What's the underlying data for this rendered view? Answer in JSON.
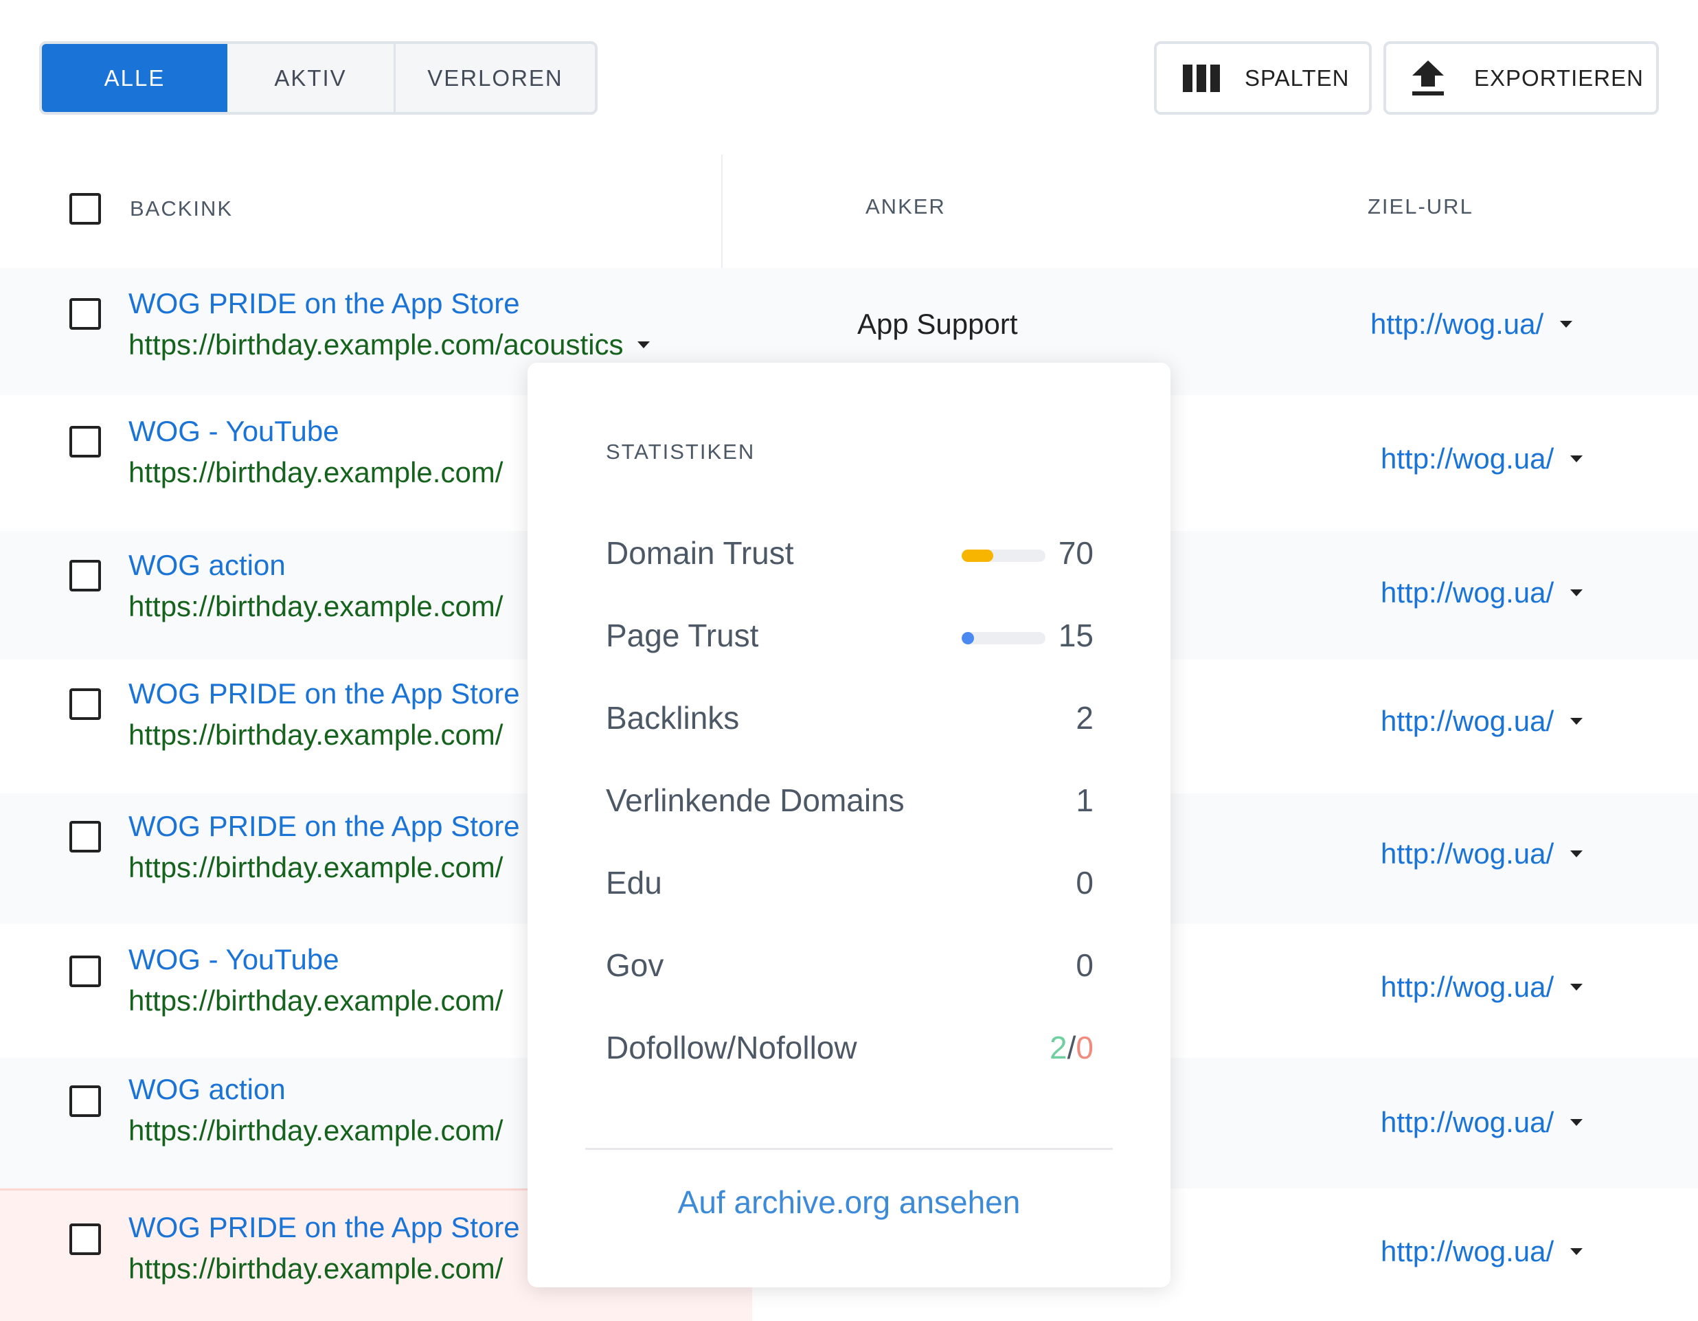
{
  "filters": {
    "tabs": [
      {
        "label": "ALLE",
        "active": true
      },
      {
        "label": "AKTIV",
        "active": false
      },
      {
        "label": "VERLOREN",
        "active": false
      }
    ]
  },
  "toolbar": {
    "columns_label": "SPALTEN",
    "columns_icon": "columns-icon",
    "export_label": "EXPORTIEREN",
    "export_icon": "upload-icon"
  },
  "table": {
    "headers": {
      "backlink": "BACKINK",
      "anchor": "ANKER",
      "target": "ZIEL-URL"
    },
    "rows": [
      {
        "title": "WOG PRIDE on the App Store",
        "url": "https://birthday.example.com/acoustics",
        "anchor": "App Support",
        "target": "http://wog.ua/"
      },
      {
        "title": "WOG - YouTube",
        "url": "https://birthday.example.com/",
        "anchor": "",
        "target": "http://wog.ua/"
      },
      {
        "title": "WOG action",
        "url": "https://birthday.example.com/",
        "anchor": "",
        "target": "http://wog.ua/"
      },
      {
        "title": "WOG PRIDE on the App Store",
        "url": "https://birthday.example.com/",
        "anchor": "",
        "target": "http://wog.ua/"
      },
      {
        "title": "WOG PRIDE on the App Store",
        "url": "https://birthday.example.com/",
        "anchor": "",
        "target": "http://wog.ua/"
      },
      {
        "title": "WOG - YouTube",
        "url": "https://birthday.example.com/",
        "anchor": "",
        "target": "http://wog.ua/"
      },
      {
        "title": "WOG action",
        "url": "https://birthday.example.com/",
        "anchor": "",
        "target": "http://wog.ua/"
      },
      {
        "title": "WOG PRIDE on the App Store",
        "url": "https://birthday.example.com/",
        "anchor": "",
        "target": "http://wog.ua/"
      }
    ]
  },
  "stats": {
    "heading": "STATISTIKEN",
    "domain_trust": {
      "label": "Domain Trust",
      "value": "70",
      "bar_fraction": 0.38,
      "bar_color": "#f7b500"
    },
    "page_trust": {
      "label": "Page Trust",
      "value": "15",
      "bar_fraction": 0.15,
      "bar_color": "#4a8af0"
    },
    "backlinks": {
      "label": "Backlinks",
      "value": "2"
    },
    "ref_domains": {
      "label": "Verlinkende Domains",
      "value": "1"
    },
    "edu": {
      "label": "Edu",
      "value": "0"
    },
    "gov": {
      "label": "Gov",
      "value": "0"
    },
    "follow": {
      "label": "Dofollow/Nofollow",
      "dofollow": "2",
      "separator": "/",
      "nofollow": "0"
    },
    "archive_link": "Auf archive.org ansehen"
  },
  "colors": {
    "accent": "#1a73d6",
    "url_green": "#14621c",
    "dofollow": "#6fcf9f",
    "nofollow": "#f28b7d"
  }
}
